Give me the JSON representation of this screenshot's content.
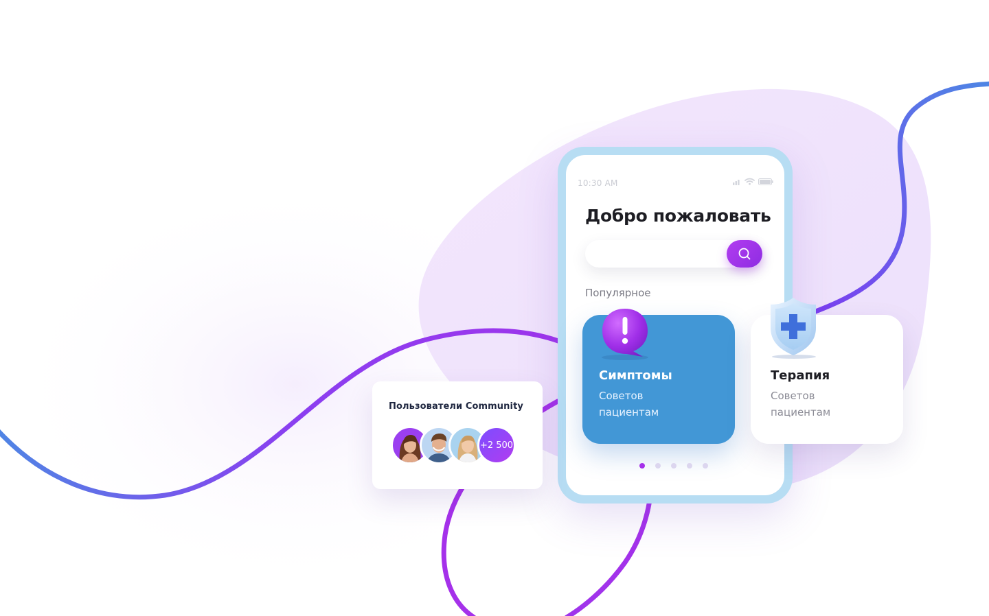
{
  "phone": {
    "status_time": "10:30 AM",
    "welcome_title": "Добро пожаловать",
    "popular_label": "Популярное"
  },
  "cards": [
    {
      "title": "Симптомы",
      "subtitle_line1": "Советов",
      "subtitle_line2": "пациентам",
      "icon": "alert-bubble-icon",
      "color": "#4297d6"
    },
    {
      "title": "Терапия",
      "subtitle_line1": "Советов",
      "subtitle_line2": "пациентам",
      "icon": "medical-shield-icon",
      "color": "#ffffff"
    }
  ],
  "pagination": {
    "total": 5,
    "active": 1
  },
  "community": {
    "title": "Пользователи Community",
    "more_count": "+2 500"
  },
  "colors": {
    "accent": "#a531ea",
    "blue_card": "#4297d6",
    "phone_frame": "#b7ddf3",
    "line_purple": "#a531ea",
    "line_blue": "#4e86e4"
  }
}
